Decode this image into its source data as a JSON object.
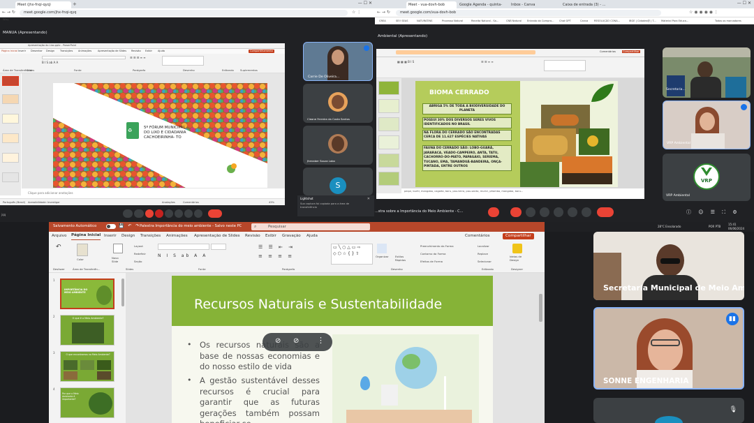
{
  "left_window": {
    "tabs": [
      "Meet (jhx-fnqi-qyq)"
    ],
    "url": "meet.google.com/jhx-fnqi-qyq",
    "bookmark": "Wizy",
    "presenting": "MANUA (Apresentando)",
    "ppt": {
      "file": "Apresentação do Lixo.pptx - PowerPoint",
      "menu": [
        "Página Inicial",
        "Inserir",
        "Desenhar",
        "Design",
        "Transições",
        "Animações",
        "Apresentação de Slides",
        "Revisão",
        "Exibir",
        "Ajuda"
      ],
      "share": "Compartilhamento",
      "groups": [
        "Área de Transferência",
        "Slides",
        "Fonte",
        "Parágrafo",
        "Desenho",
        "Editando",
        "Suplementos"
      ],
      "slide_title": "5º FÓRUM MUNICIPAL DO LIXO E CIDADANIA CACHOEIRINHA- TO",
      "notes": "Clique para adicionar anotações",
      "status": [
        "Português (Brasil)",
        "Acessibilidade: Investigar"
      ],
      "zoom": "43%",
      "anotacoes": "Anotações",
      "comentarios": "Comentários"
    },
    "participants": [
      "Carrie De Oliveira...",
      "Cleane Ferreira da Costa Santos",
      "Jhenaber Souza Lobo",
      "S"
    ],
    "lightshot": {
      "title": "Lightshot",
      "text": "Sua captura foi copiada para a área de transferência"
    },
    "time": "jqq"
  },
  "right_window": {
    "tabs": [
      "Meet - vua-dovh-bob",
      "Google Agenda - quinta-feira...",
      "Inbox - Canva",
      "Caixa de entrada (3) - ..."
    ],
    "url": "meet.google.com/vua-dovh-bob",
    "bookmarks": [
      "CREA",
      "SEI! SEAS",
      "NATURATINS",
      "Processo Natural",
      "Receita Natural - Sa...",
      "CNB Natural",
      "Entrada da Compra...",
      "Chat GPT",
      "Canva",
      "RESOLUÇÃO CONA...",
      "IBGE | Cidades@ | T...",
      "Material Para Educa...",
      "Todos os marcadores"
    ],
    "presenting": "Ambiental (Apresentando)",
    "ppt": {
      "comments": "Comentários",
      "share": "Compartilhar",
      "slide_title": "BIOMA CERRADO",
      "box1": "ABRIGA 5% DE TODA A BIODIVERSIDADE DO PLANETA",
      "box2": "POSSUI 30% DOS DIVERSOS SERES VIVOS IDENTIFICADOS NO BRASIL",
      "box3": "NA FLORA DO CERRADO SÃO ENCONTRADAS CERCA DE 11.627 ESPÉCIES NATIVAS",
      "box4": "FAUNA DO CERRADO SÃO: LOBO-GUARÁ, JARARACA, VEADO-CAMPEIRO, ANTA, TATU, CACHORRO-DO-MATO, PAPAGAIO, SERIEMA, TUCANO, EMA, TAMANDUÁ-BANDEIRA, ONÇA-PINTADA, ENTRE OUTROS",
      "notes": "pequi, buriti, mangaba, cagaita, baru, pau-terra, pau-santo, murici, pitomba, mangaba, baru..."
    },
    "meeting_title": "...stra sobre a Importância do Meio Ambiente - C...",
    "participants": [
      "Secretaria...",
      "VRP Ambiental",
      "VRP Ambiental"
    ],
    "vrp_logo": "VRP"
  },
  "taskbar": {
    "weather": "28°C  Ensolarado",
    "time": "15:41",
    "date": "06/06/2024",
    "lang": "POR PTB"
  },
  "bottom_left": {
    "autosave": "Salvamento Automático",
    "file_title": "Palestra Importância do meio ambiente - Salvo neste PC",
    "search": "Pesquisar",
    "menu": [
      "Arquivo",
      "Página Inicial",
      "Inserir",
      "Design",
      "Transições",
      "Animações",
      "Apresentação de Slides",
      "Revisão",
      "Exibir",
      "Gravação",
      "Ajuda"
    ],
    "comments": "Comentários",
    "share": "Compartilhar",
    "ribbon": {
      "undo": "Desfazer",
      "clipboard": "Área de Transferên...",
      "paste": "Colar",
      "new_slide": "Novo Slide",
      "slides": "Slides",
      "layout": "Layout",
      "reset": "Redefinir",
      "section": "Seção",
      "fonte": "Fonte",
      "paragrafo": "Parágrafo",
      "organizar": "Organizar",
      "estilos": "Estilos Rápidos",
      "desenho": "Desenho",
      "preenchimento": "Preenchimento da Forma",
      "contorno": "Contorno da Forma",
      "efeitos": "Efeitos de Forma",
      "localizar": "Localizar",
      "substituir": "Replace",
      "selecionar": "Selecionar",
      "editando": "Editando",
      "ideias": "Ideias de Design",
      "designer": "Designer"
    },
    "thumbs": [
      {
        "num": "1",
        "text": "IMPORTÂNCIA DO MEIO AMBIENTE"
      },
      {
        "num": "2",
        "text": "O que é o Meio Ambiente?"
      },
      {
        "num": "3",
        "text": "O que encontramos no Meio Ambiente?"
      },
      {
        "num": "4",
        "text": "Por que o Meio Ambiente é importante?"
      }
    ],
    "slide_title": "Recursos Naturais e Sustentabilidade",
    "bullet1": "Os recursos naturais são a base de nossas economias e do nosso estilo de vida",
    "bullet2": "A gestão sustentável desses recursos é crucial para garantir que as futuras gerações também possam beneficiar-se"
  },
  "bottom_right": {
    "participants": [
      "Secretaria Municipal de Meio Amb...",
      "SONNE ENGENHARIA"
    ]
  }
}
